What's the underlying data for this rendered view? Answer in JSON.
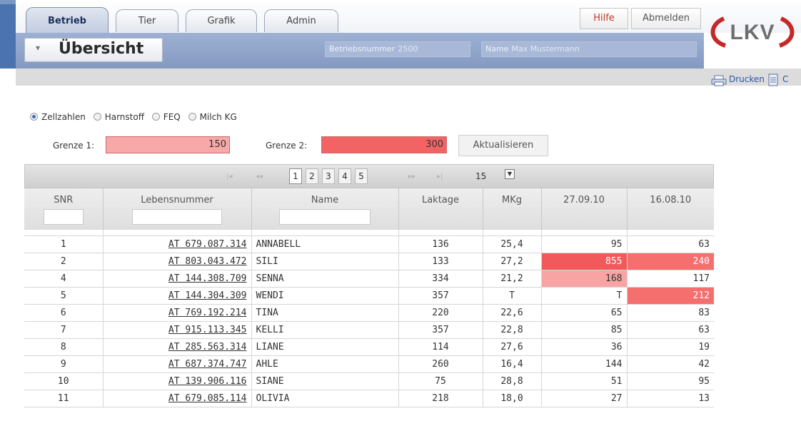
{
  "tabs": [
    "Betrieb",
    "Tier",
    "Grafik",
    "Admin"
  ],
  "header_buttons": {
    "help": "Hilfe",
    "logout": "Abmelden"
  },
  "logo_text": "LKV",
  "page": {
    "title": "Übersicht",
    "farm_number_label": "Betriebsnummer",
    "farm_number_value": "2500",
    "name_label": "Name",
    "name_value": "Max Mustermann"
  },
  "toolbar": {
    "print_label": "Drucken",
    "cut_label": "C"
  },
  "filters": {
    "options": [
      "Zellzahlen",
      "Harnstoff",
      "FEQ",
      "Milch KG"
    ],
    "selected": "Zellzahlen",
    "limit1_label": "Grenze 1:",
    "limit1_value": "150",
    "limit2_label": "Grenze 2:",
    "limit2_value": "300",
    "refresh_label": "Aktualisieren"
  },
  "pager": {
    "pages": [
      "1",
      "2",
      "3",
      "4",
      "5"
    ],
    "current": "1",
    "page_size": "15",
    "nav_glyphs": [
      "|◂",
      "◂◂",
      "▸▸",
      "▸|"
    ]
  },
  "colors": {
    "limit1": "#f7a8a8",
    "limit2": "#f26464",
    "header_blue": "#8c9fc7",
    "accent_red": "#c0392b"
  },
  "table": {
    "columns": [
      "SNR",
      "Lebensnummer",
      "Name",
      "Laktage",
      "MKg",
      "27.09.10",
      "16.08.10"
    ],
    "rows": [
      [
        "1",
        "AT 679.087.314",
        "ANNABELL",
        "136",
        "25,4",
        "95",
        "63"
      ],
      [
        "2",
        "AT 803.043.472",
        "SILI",
        "133",
        "27,2",
        "855",
        "240"
      ],
      [
        "4",
        "AT 144.308.709",
        "SENNA",
        "334",
        "21,2",
        "168",
        "117"
      ],
      [
        "5",
        "AT 144.304.309",
        "WENDI",
        "357",
        "T",
        "T",
        "212"
      ],
      [
        "6",
        "AT 769.192.214",
        "TINA",
        "220",
        "22,6",
        "65",
        "83"
      ],
      [
        "7",
        "AT 915.113.345",
        "KELLI",
        "357",
        "22,8",
        "85",
        "63"
      ],
      [
        "8",
        "AT 285.563.314",
        "LIANE",
        "114",
        "27,6",
        "36",
        "19"
      ],
      [
        "9",
        "AT 687.374.747",
        "AHLE",
        "260",
        "16,4",
        "144",
        "42"
      ],
      [
        "10",
        "AT 139.906.116",
        "SIANE",
        "75",
        "28,8",
        "51",
        "95"
      ],
      [
        "11",
        "AT 679.085.114",
        "OLIVIA",
        "218",
        "18,0",
        "27",
        "13"
      ]
    ],
    "highlights": {
      "1": {
        "5": "hl2",
        "6": "hl3"
      },
      "2": {
        "5": "hl1"
      },
      "3": {
        "6": "hl3"
      }
    }
  }
}
